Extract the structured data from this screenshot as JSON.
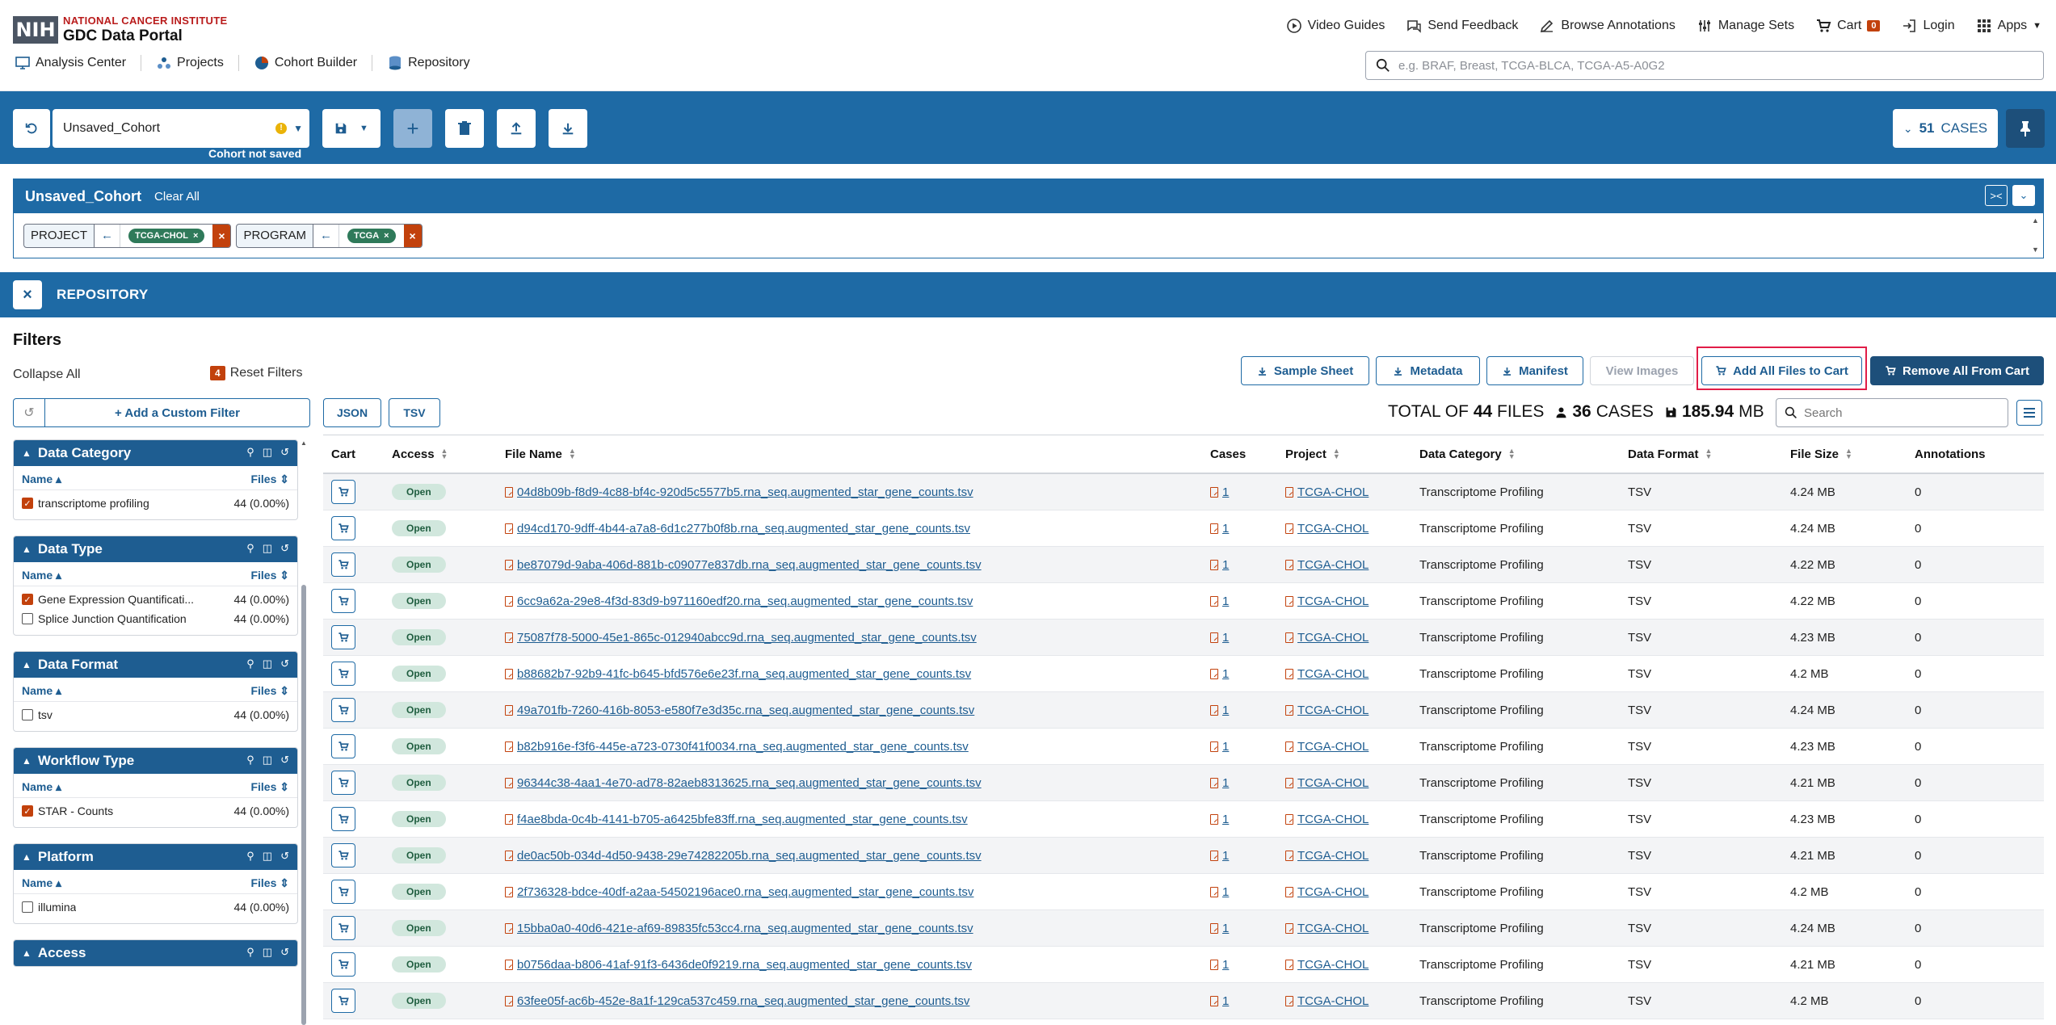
{
  "header": {
    "logo_box": "NIH",
    "logo_line1": "NATIONAL CANCER INSTITUTE",
    "logo_line2": "GDC Data Portal",
    "nav": {
      "video_guides": "Video Guides",
      "send_feedback": "Send Feedback",
      "browse_annotations": "Browse Annotations",
      "manage_sets": "Manage Sets",
      "cart": "Cart",
      "cart_count": "0",
      "login": "Login",
      "apps": "Apps"
    },
    "secondary": {
      "analysis_center": "Analysis Center",
      "projects": "Projects",
      "cohort_builder": "Cohort Builder",
      "repository": "Repository"
    },
    "search_placeholder": "e.g. BRAF, Breast, TCGA-BLCA, TCGA-A5-A0G2"
  },
  "cohort": {
    "name": "Unsaved_Cohort",
    "warn": "!",
    "status": "Cohort not saved",
    "cases_count": "51",
    "cases_label": "CASES"
  },
  "filter_summary": {
    "title": "Unsaved_Cohort",
    "clear_all": "Clear All",
    "chips": [
      {
        "key": "PROJECT",
        "value": "TCGA-CHOL"
      },
      {
        "key": "PROGRAM",
        "value": "TCGA"
      }
    ]
  },
  "repository": {
    "title": "REPOSITORY"
  },
  "filters": {
    "title": "Filters",
    "collapse_all": "Collapse All",
    "reset_count": "4",
    "reset_label": "Reset Filters",
    "add_custom": "+ Add a Custom Filter",
    "name_col": "Name",
    "files_col": "Files",
    "facets": [
      {
        "title": "Data Category",
        "rows": [
          {
            "label": "transcriptome profiling",
            "count": "44 (0.00%)",
            "checked": true
          }
        ]
      },
      {
        "title": "Data Type",
        "rows": [
          {
            "label": "Gene Expression Quantificati...",
            "count": "44 (0.00%)",
            "checked": true
          },
          {
            "label": "Splice Junction Quantification",
            "count": "44 (0.00%)",
            "checked": false
          }
        ]
      },
      {
        "title": "Data Format",
        "rows": [
          {
            "label": "tsv",
            "count": "44 (0.00%)",
            "checked": false
          }
        ]
      },
      {
        "title": "Workflow Type",
        "rows": [
          {
            "label": "STAR - Counts",
            "count": "44 (0.00%)",
            "checked": true
          }
        ]
      },
      {
        "title": "Platform",
        "rows": [
          {
            "label": "illumina",
            "count": "44 (0.00%)",
            "checked": false
          }
        ]
      },
      {
        "title": "Access",
        "rows": []
      }
    ]
  },
  "actions": {
    "sample_sheet": "Sample Sheet",
    "metadata": "Metadata",
    "manifest": "Manifest",
    "view_images": "View Images",
    "add_all": "Add All Files to Cart",
    "remove_all": "Remove All From Cart",
    "json": "JSON",
    "tsv": "TSV"
  },
  "totals": {
    "prefix": "TOTAL OF",
    "files_count": "44",
    "files_label": "FILES",
    "cases_count": "36",
    "cases_label": "CASES",
    "size_value": "185.94",
    "size_unit": "MB",
    "search_placeholder": "Search"
  },
  "table": {
    "headers": {
      "cart": "Cart",
      "access": "Access",
      "file_name": "File Name",
      "cases": "Cases",
      "project": "Project",
      "data_category": "Data Category",
      "data_format": "Data Format",
      "file_size": "File Size",
      "annotations": "Annotations"
    },
    "rows": [
      {
        "access": "Open",
        "file": "04d8b09b-f8d9-4c88-bf4c-920d5c5577b5.rna_seq.augmented_star_gene_counts.tsv",
        "cases": "1",
        "project": "TCGA-CHOL",
        "category": "Transcriptome Profiling",
        "format": "TSV",
        "size": "4.24 MB",
        "ann": "0"
      },
      {
        "access": "Open",
        "file": "d94cd170-9dff-4b44-a7a8-6d1c277b0f8b.rna_seq.augmented_star_gene_counts.tsv",
        "cases": "1",
        "project": "TCGA-CHOL",
        "category": "Transcriptome Profiling",
        "format": "TSV",
        "size": "4.24 MB",
        "ann": "0"
      },
      {
        "access": "Open",
        "file": "be87079d-9aba-406d-881b-c09077e837db.rna_seq.augmented_star_gene_counts.tsv",
        "cases": "1",
        "project": "TCGA-CHOL",
        "category": "Transcriptome Profiling",
        "format": "TSV",
        "size": "4.22 MB",
        "ann": "0"
      },
      {
        "access": "Open",
        "file": "6cc9a62a-29e8-4f3d-83d9-b971160edf20.rna_seq.augmented_star_gene_counts.tsv",
        "cases": "1",
        "project": "TCGA-CHOL",
        "category": "Transcriptome Profiling",
        "format": "TSV",
        "size": "4.22 MB",
        "ann": "0"
      },
      {
        "access": "Open",
        "file": "75087f78-5000-45e1-865c-012940abcc9d.rna_seq.augmented_star_gene_counts.tsv",
        "cases": "1",
        "project": "TCGA-CHOL",
        "category": "Transcriptome Profiling",
        "format": "TSV",
        "size": "4.23 MB",
        "ann": "0"
      },
      {
        "access": "Open",
        "file": "b88682b7-92b9-41fc-b645-bfd576e6e23f.rna_seq.augmented_star_gene_counts.tsv",
        "cases": "1",
        "project": "TCGA-CHOL",
        "category": "Transcriptome Profiling",
        "format": "TSV",
        "size": "4.2 MB",
        "ann": "0"
      },
      {
        "access": "Open",
        "file": "49a701fb-7260-416b-8053-e580f7e3d35c.rna_seq.augmented_star_gene_counts.tsv",
        "cases": "1",
        "project": "TCGA-CHOL",
        "category": "Transcriptome Profiling",
        "format": "TSV",
        "size": "4.24 MB",
        "ann": "0"
      },
      {
        "access": "Open",
        "file": "b82b916e-f3f6-445e-a723-0730f41f0034.rna_seq.augmented_star_gene_counts.tsv",
        "cases": "1",
        "project": "TCGA-CHOL",
        "category": "Transcriptome Profiling",
        "format": "TSV",
        "size": "4.23 MB",
        "ann": "0"
      },
      {
        "access": "Open",
        "file": "96344c38-4aa1-4e70-ad78-82aeb8313625.rna_seq.augmented_star_gene_counts.tsv",
        "cases": "1",
        "project": "TCGA-CHOL",
        "category": "Transcriptome Profiling",
        "format": "TSV",
        "size": "4.21 MB",
        "ann": "0"
      },
      {
        "access": "Open",
        "file": "f4ae8bda-0c4b-4141-b705-a6425bfe83ff.rna_seq.augmented_star_gene_counts.tsv",
        "cases": "1",
        "project": "TCGA-CHOL",
        "category": "Transcriptome Profiling",
        "format": "TSV",
        "size": "4.23 MB",
        "ann": "0"
      },
      {
        "access": "Open",
        "file": "de0ac50b-034d-4d50-9438-29e74282205b.rna_seq.augmented_star_gene_counts.tsv",
        "cases": "1",
        "project": "TCGA-CHOL",
        "category": "Transcriptome Profiling",
        "format": "TSV",
        "size": "4.21 MB",
        "ann": "0"
      },
      {
        "access": "Open",
        "file": "2f736328-bdce-40df-a2aa-54502196ace0.rna_seq.augmented_star_gene_counts.tsv",
        "cases": "1",
        "project": "TCGA-CHOL",
        "category": "Transcriptome Profiling",
        "format": "TSV",
        "size": "4.2 MB",
        "ann": "0"
      },
      {
        "access": "Open",
        "file": "15bba0a0-40d6-421e-af69-89835fc53cc4.rna_seq.augmented_star_gene_counts.tsv",
        "cases": "1",
        "project": "TCGA-CHOL",
        "category": "Transcriptome Profiling",
        "format": "TSV",
        "size": "4.24 MB",
        "ann": "0"
      },
      {
        "access": "Open",
        "file": "b0756daa-b806-41af-91f3-6436de0f9219.rna_seq.augmented_star_gene_counts.tsv",
        "cases": "1",
        "project": "TCGA-CHOL",
        "category": "Transcriptome Profiling",
        "format": "TSV",
        "size": "4.21 MB",
        "ann": "0"
      },
      {
        "access": "Open",
        "file": "63fee05f-ac6b-452e-8a1f-129ca537c459.rna_seq.augmented_star_gene_counts.tsv",
        "cases": "1",
        "project": "TCGA-CHOL",
        "category": "Transcriptome Profiling",
        "format": "TSV",
        "size": "4.2 MB",
        "ann": "0"
      }
    ]
  },
  "icons": {
    "video": "play-circle-icon",
    "feedback": "chat-icon",
    "annotations": "pencil-icon",
    "sets": "sliders-icon",
    "cart": "cart-icon",
    "login": "login-icon",
    "apps": "grid-icon"
  },
  "colors": {
    "primary": "#1e6aa5",
    "dark": "#1d4f7a",
    "accent": "#c2410c",
    "open_badge": "#d1e7dd",
    "highlight": "#e11d48"
  }
}
